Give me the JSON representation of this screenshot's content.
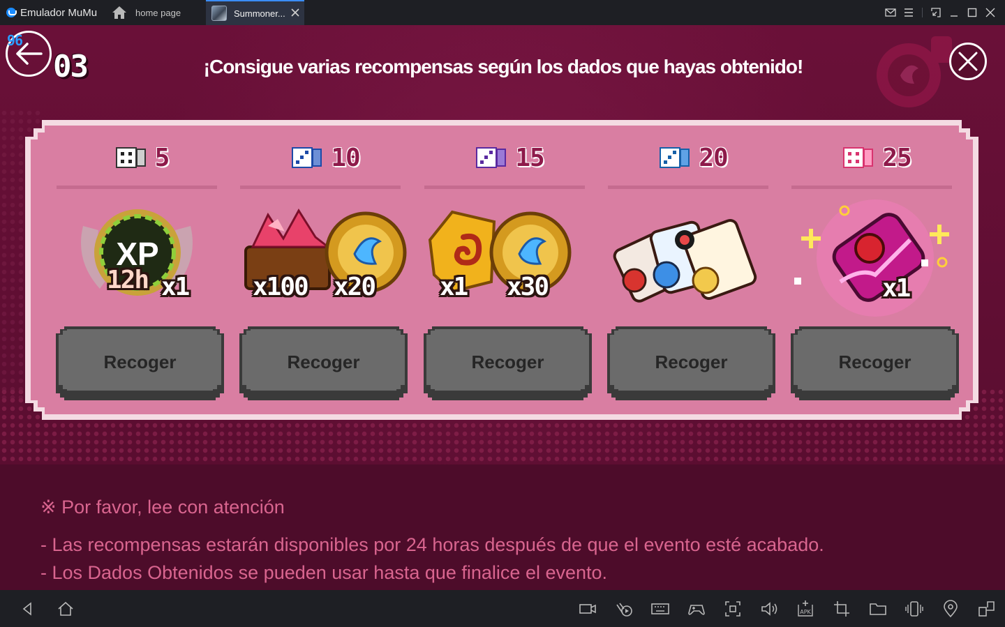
{
  "window": {
    "app_name": "Emulador MuMu",
    "home_tab_label": "home page",
    "game_tab_label": "Summoner..."
  },
  "game": {
    "fps": "96",
    "step_number": "03",
    "headline": "¡Consigue varias recompensas según los dados que hayas obtenido!",
    "rewards": [
      {
        "dice_count": "5",
        "quantities": [
          "12h",
          "x1"
        ],
        "art": "xp-boost-badge-icon",
        "button_label": "Recoger"
      },
      {
        "dice_count": "10",
        "quantities": [
          "x100",
          "x20"
        ],
        "art": "gem-chest-and-coin-icon",
        "button_label": "Recoger"
      },
      {
        "dice_count": "15",
        "quantities": [
          "x1",
          "x30"
        ],
        "art": "gold-swirl-and-coin-icon",
        "button_label": "Recoger"
      },
      {
        "dice_count": "20",
        "quantities": [],
        "art": "summon-scrolls-icon",
        "button_label": "Recoger"
      },
      {
        "dice_count": "25",
        "quantities": [
          "x1"
        ],
        "art": "legendary-scroll-icon",
        "button_label": "Recoger"
      }
    ],
    "notes_title": "※ Por favor, lee con atención",
    "notes": [
      "- Las recompensas estarán disponibles por 24 horas después de que el evento esté acabado.",
      "- Los Dados Obtenidos se pueden usar hasta que finalice el evento."
    ]
  },
  "colors": {
    "titlebar": "#1e1f24",
    "tab_accent": "#3a8dff",
    "game_bg": "#5d0f31",
    "panel": "#d97ea2",
    "panel_border": "#f4dbe3",
    "button": "#6b6b6b",
    "note_text": "#d9658f",
    "dice_text": "#8e1a4a"
  }
}
